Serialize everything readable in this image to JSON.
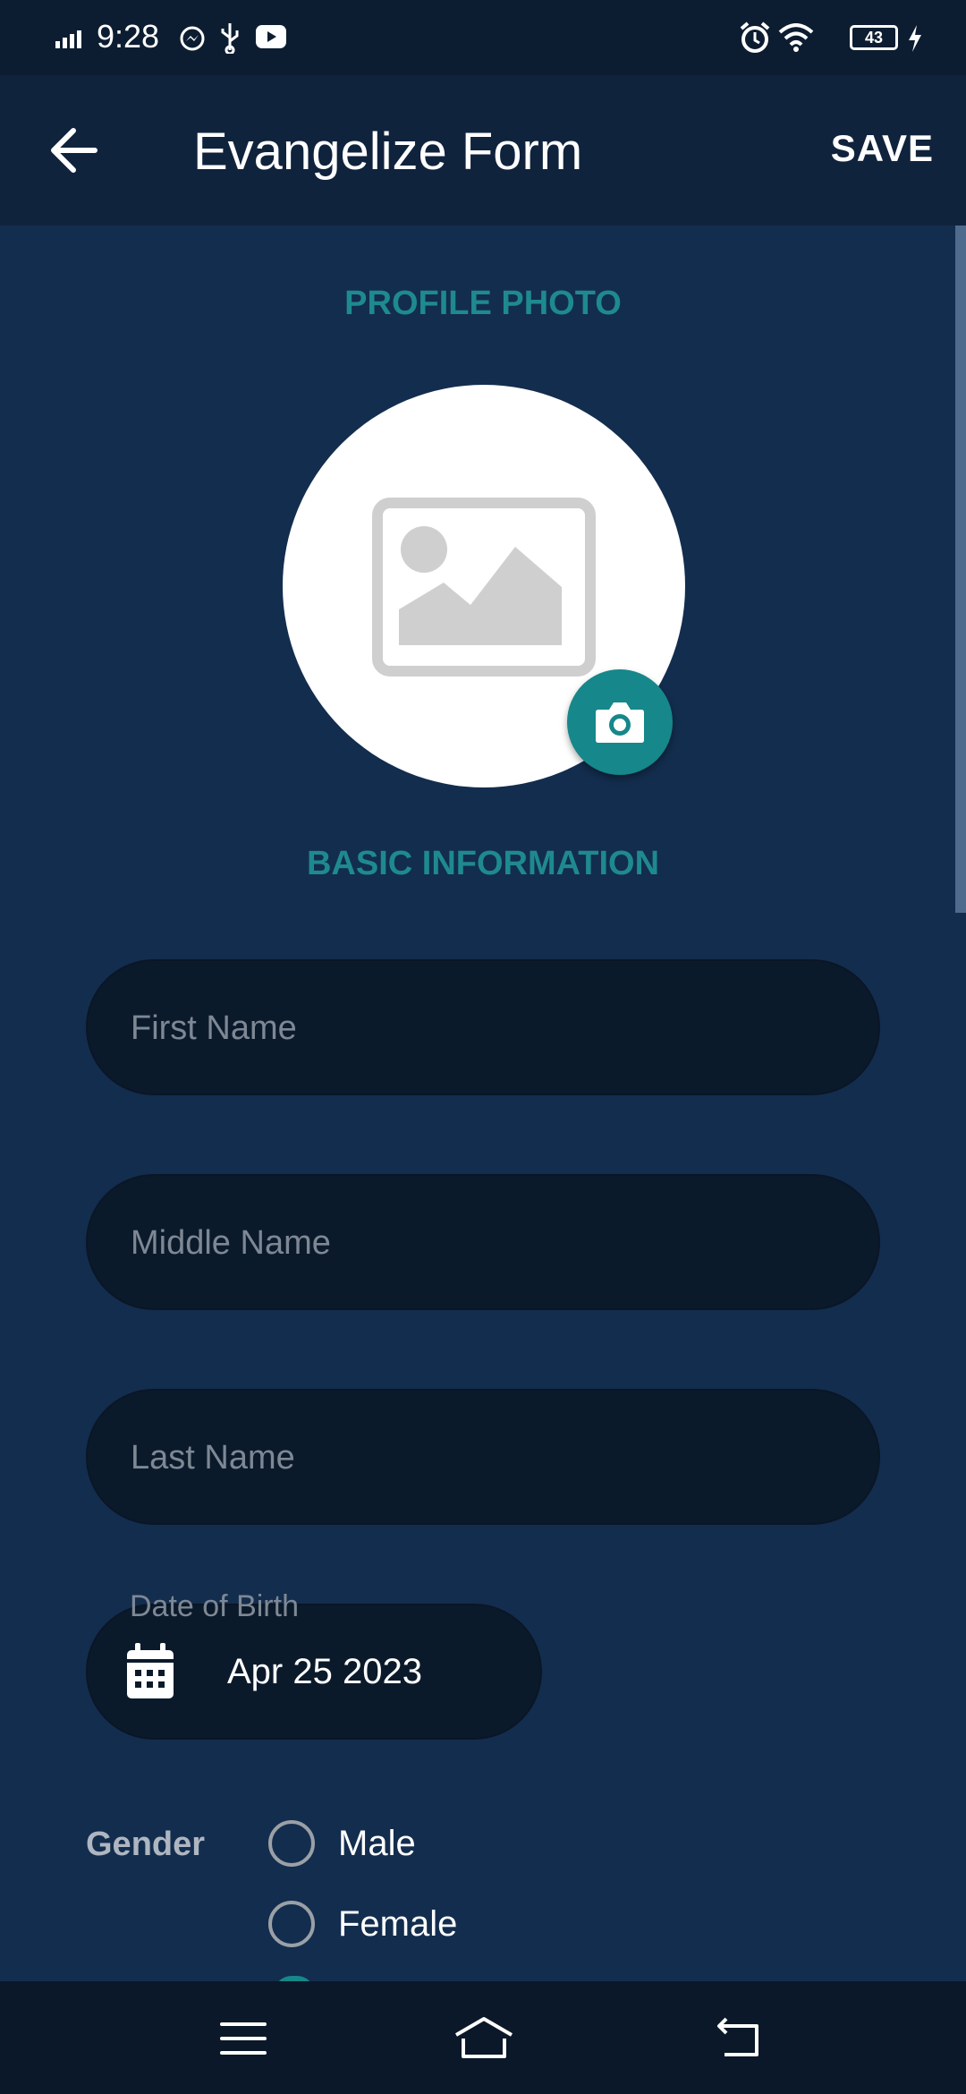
{
  "status_bar": {
    "time": "9:28",
    "battery": "43",
    "icons": [
      "signal-icon",
      "messenger-icon",
      "usb-icon",
      "youtube-icon",
      "alarm-icon",
      "wifi-icon",
      "battery-icon",
      "charging-icon"
    ]
  },
  "app_bar": {
    "title": "Evangelize Form",
    "save_label": "SAVE"
  },
  "profile_section": {
    "title": "PROFILE PHOTO"
  },
  "basic_info": {
    "title": "BASIC INFORMATION",
    "first_name_placeholder": "First Name",
    "middle_name_placeholder": "Middle Name",
    "last_name_placeholder": "Last Name",
    "first_name_value": "",
    "middle_name_value": "",
    "last_name_value": "",
    "dob_label": "Date of Birth",
    "dob_value": "Apr 25 2023"
  },
  "gender": {
    "label": "Gender",
    "options": [
      "Male",
      "Female"
    ]
  },
  "colors": {
    "accent": "#16878a",
    "background": "#132d4e",
    "appbar": "#10233d",
    "field": "#0b1a2b"
  }
}
